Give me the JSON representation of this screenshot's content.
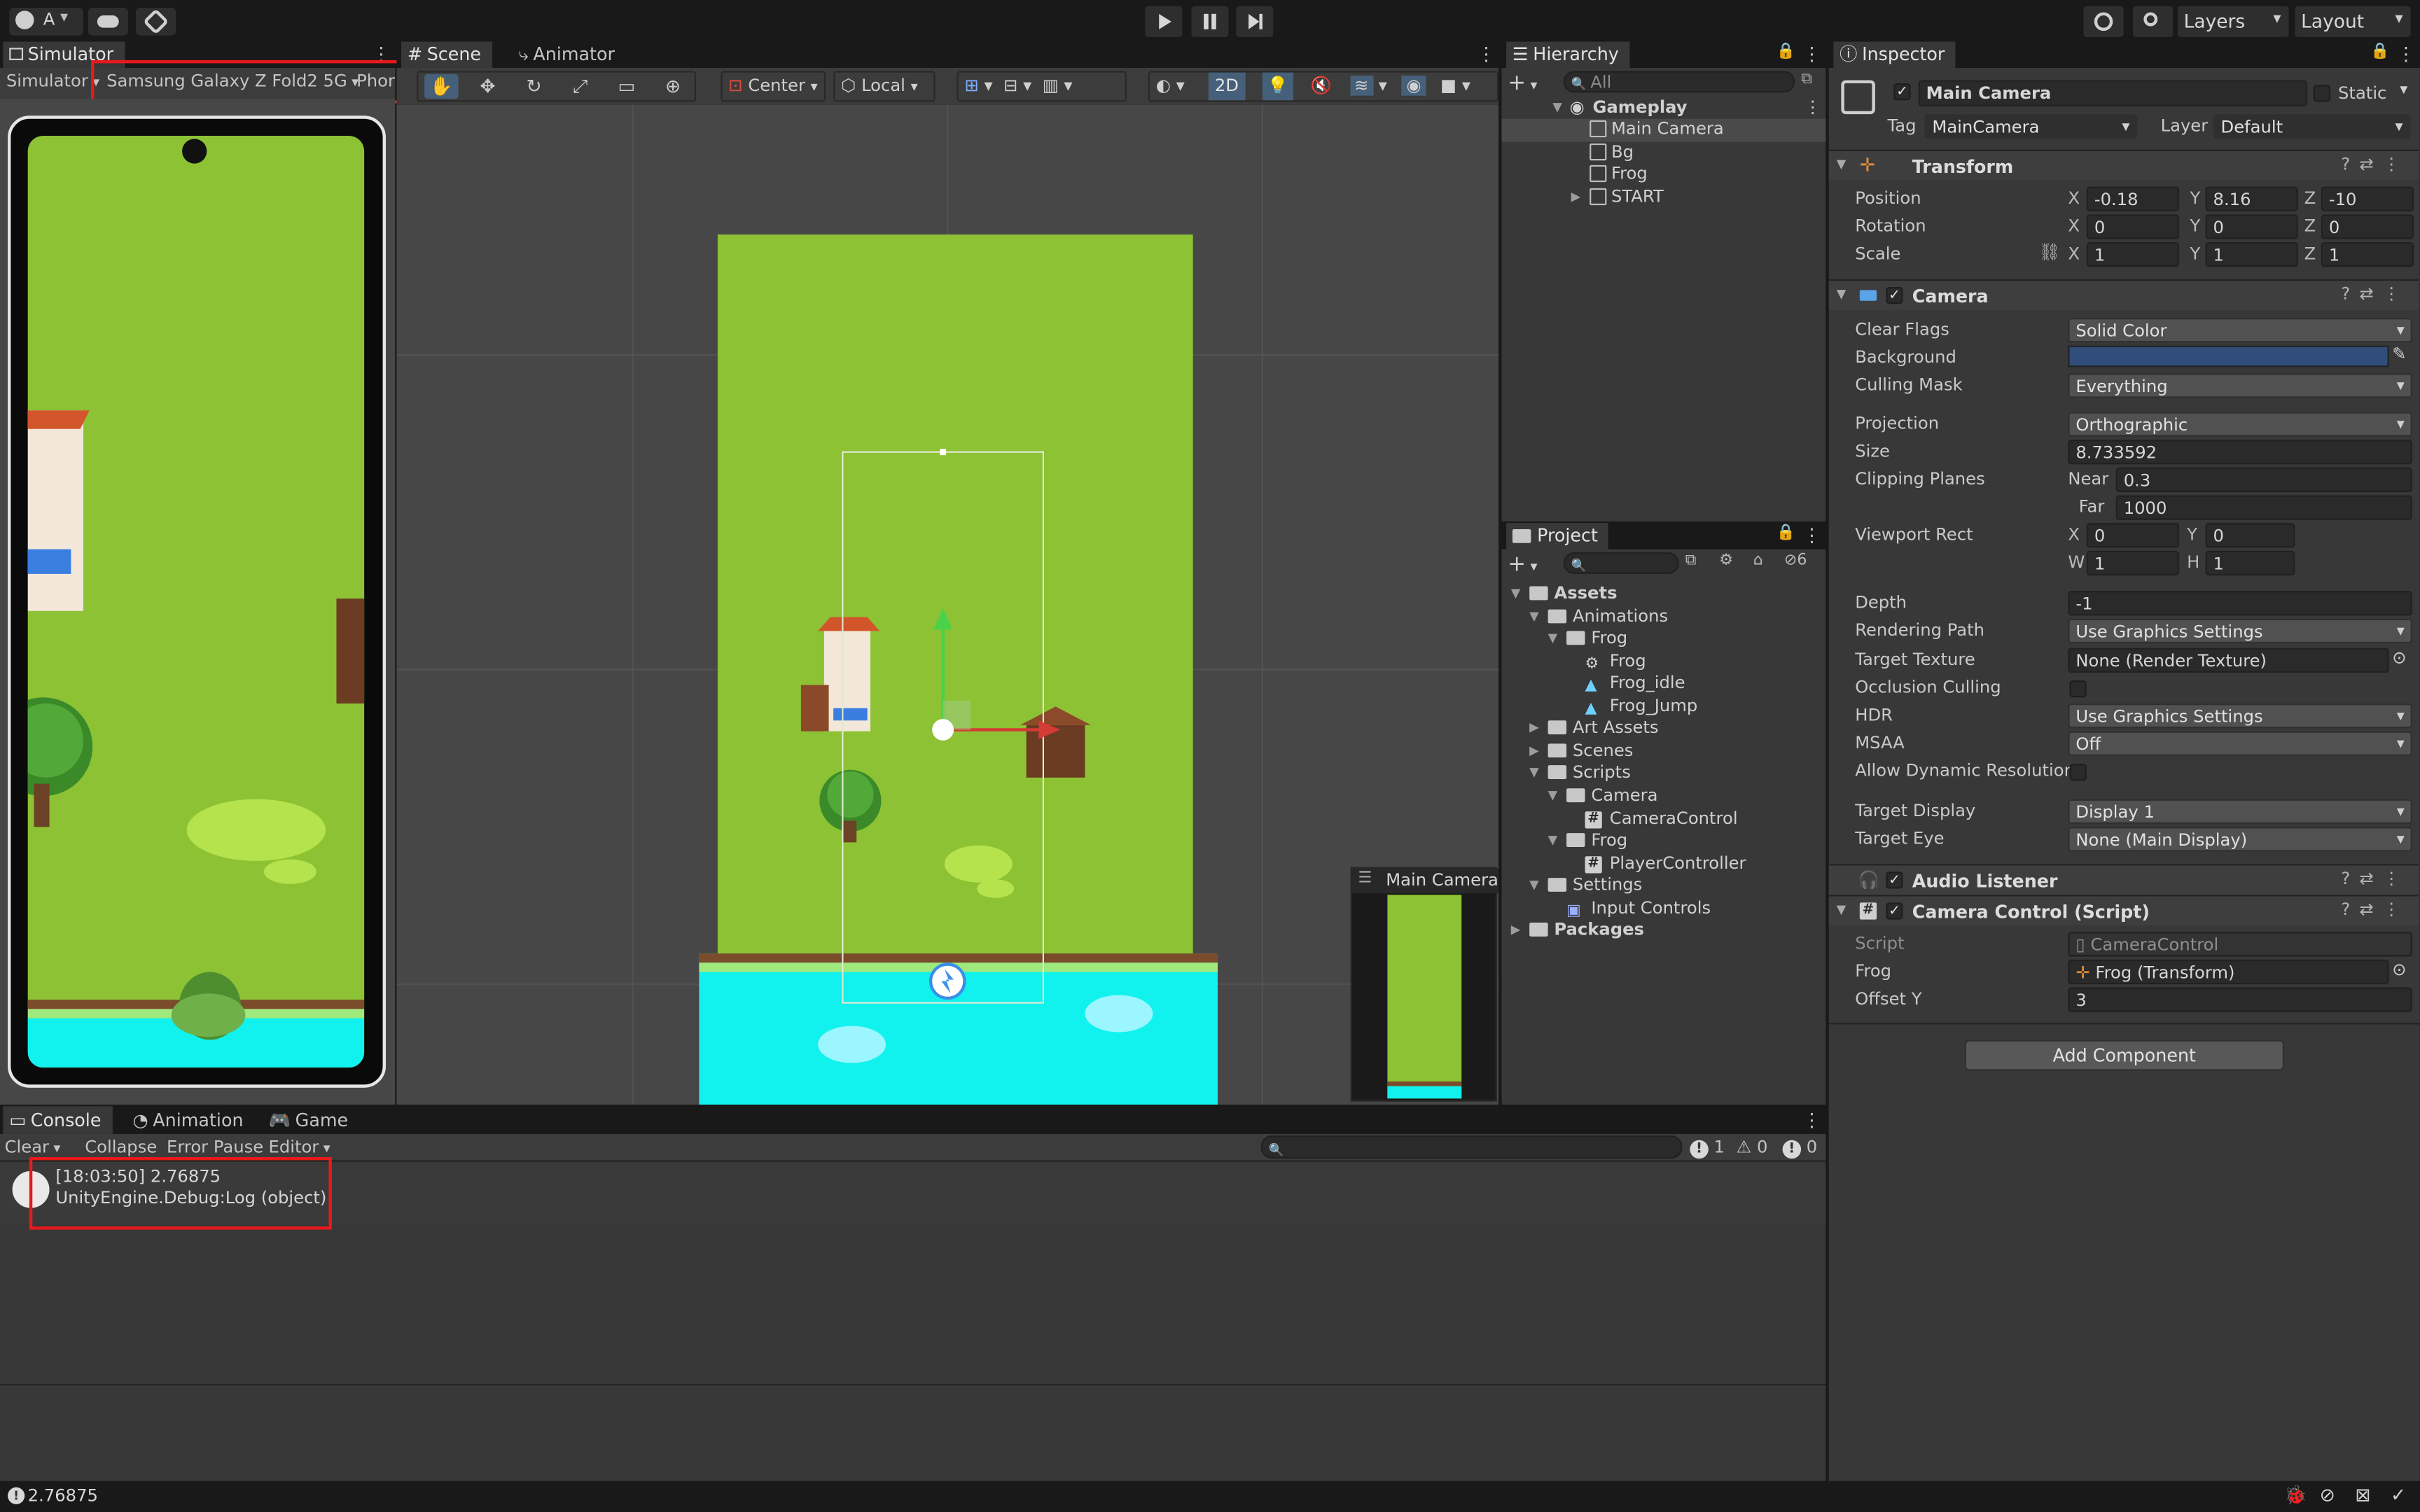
{
  "toolbar": {
    "account": "A",
    "account_arrow": "▾",
    "layers": "Layers",
    "layout": "Layout"
  },
  "simulator": {
    "tab": "Simulator",
    "mode": "Simulator",
    "device": "Samsung Galaxy Z Fold2 5G",
    "phone_tab": "Phor"
  },
  "scene": {
    "tab_scene": "Scene",
    "tab_animator": "Animator",
    "pivot": "Center",
    "space": "Local",
    "mode_2d": "2D",
    "camera_preview_title": "Main Camera"
  },
  "hierarchy": {
    "tab": "Hierarchy",
    "search_placeholder": "All",
    "root": "Gameplay",
    "items": [
      "Main Camera",
      "Bg",
      "Frog",
      "START"
    ]
  },
  "project": {
    "tab": "Project",
    "hidden_count": "6",
    "tree": [
      {
        "label": "Assets",
        "depth": 0,
        "kind": "folder",
        "open": true
      },
      {
        "label": "Animations",
        "depth": 1,
        "kind": "folder",
        "open": true
      },
      {
        "label": "Frog",
        "depth": 2,
        "kind": "folder",
        "open": true
      },
      {
        "label": "Frog",
        "depth": 3,
        "kind": "controller"
      },
      {
        "label": "Frog_idle",
        "depth": 3,
        "kind": "anim"
      },
      {
        "label": "Frog_Jump",
        "depth": 3,
        "kind": "anim"
      },
      {
        "label": "Art Assets",
        "depth": 1,
        "kind": "folder",
        "open": false
      },
      {
        "label": "Scenes",
        "depth": 1,
        "kind": "folder",
        "open": false
      },
      {
        "label": "Scripts",
        "depth": 1,
        "kind": "folder",
        "open": true
      },
      {
        "label": "Camera",
        "depth": 2,
        "kind": "folder",
        "open": true
      },
      {
        "label": "CameraControl",
        "depth": 3,
        "kind": "script"
      },
      {
        "label": "Frog",
        "depth": 2,
        "kind": "folder",
        "open": true
      },
      {
        "label": "PlayerController",
        "depth": 3,
        "kind": "script"
      },
      {
        "label": "Settings",
        "depth": 1,
        "kind": "folder",
        "open": true
      },
      {
        "label": "Input Controls",
        "depth": 2,
        "kind": "input"
      },
      {
        "label": "Packages",
        "depth": 0,
        "kind": "folder",
        "open": false
      }
    ]
  },
  "inspector": {
    "tab": "Inspector",
    "object_name": "Main Camera",
    "static_label": "Static",
    "tag_label": "Tag",
    "tag_value": "MainCamera",
    "layer_label": "Layer",
    "layer_value": "Default",
    "transform": {
      "title": "Transform",
      "position_label": "Position",
      "rotation_label": "Rotation",
      "scale_label": "Scale",
      "position": {
        "x": "-0.18",
        "y": "8.16",
        "z": "-10"
      },
      "rotation": {
        "x": "0",
        "y": "0",
        "z": "0"
      },
      "scale": {
        "x": "1",
        "y": "1",
        "z": "1"
      }
    },
    "axes": {
      "x": "X",
      "y": "Y",
      "z": "Z",
      "w": "W",
      "h": "H"
    },
    "camera": {
      "title": "Camera",
      "clear_flags_label": "Clear Flags",
      "clear_flags": "Solid Color",
      "background_label": "Background",
      "background_color": "#314d79",
      "culling_mask_label": "Culling Mask",
      "culling_mask": "Everything",
      "projection_label": "Projection",
      "projection": "Orthographic",
      "size_label": "Size",
      "size": "8.733592",
      "clipping_label": "Clipping Planes",
      "near_label": "Near",
      "near": "0.3",
      "far_label": "Far",
      "far": "1000",
      "viewport_label": "Viewport Rect",
      "vp_x": "0",
      "vp_y": "0",
      "vp_w": "1",
      "vp_h": "1",
      "depth_label": "Depth",
      "depth": "-1",
      "rendering_path_label": "Rendering Path",
      "rendering_path": "Use Graphics Settings",
      "target_texture_label": "Target Texture",
      "target_texture": "None (Render Texture)",
      "occlusion_label": "Occlusion Culling",
      "hdr_label": "HDR",
      "hdr": "Use Graphics Settings",
      "msaa_label": "MSAA",
      "msaa": "Off",
      "dynamic_res_label": "Allow Dynamic Resolution",
      "target_display_label": "Target Display",
      "target_display": "Display 1",
      "target_eye_label": "Target Eye",
      "target_eye": "None (Main Display)"
    },
    "audio_listener": {
      "title": "Audio Listener"
    },
    "camera_control": {
      "title": "Camera Control (Script)",
      "script_label": "Script",
      "script": "CameraControl",
      "frog_label": "Frog",
      "frog": "Frog (Transform)",
      "offset_label": "Offset Y",
      "offset": "3"
    },
    "add_component": "Add Component"
  },
  "console": {
    "tab_console": "Console",
    "tab_animation": "Animation",
    "tab_game": "Game",
    "clear": "Clear",
    "collapse": "Collapse",
    "error_pause": "Error Pause",
    "editor": "Editor",
    "log_count": "1",
    "warn_count": "0",
    "error_count": "0",
    "entry_line1": "[18:03:50] 2.76875",
    "entry_line2": "UnityEngine.Debug:Log (object)"
  },
  "status": {
    "message": "2.76875"
  },
  "colors": {
    "accent": "#3a79bb",
    "highlight_box": "#e8191b",
    "grass": "#8bc232",
    "water": "#11f2ee"
  }
}
